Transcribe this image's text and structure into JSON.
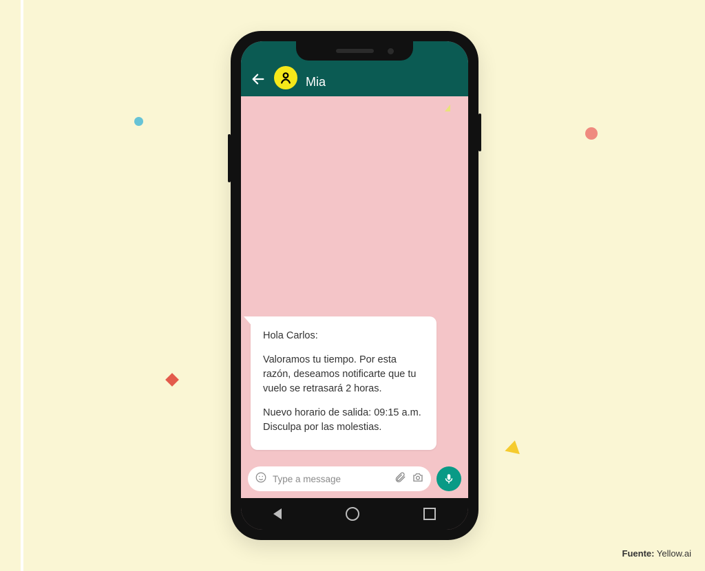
{
  "header": {
    "contact_name": "Mia"
  },
  "message": {
    "line1": "Hola Carlos:",
    "line2": "Valoramos tu tiempo. Por esta razón, deseamos notificarte que tu vuelo se retrasará 2 horas.",
    "line3": "Nuevo horario de salida: 09:15 a.m. Disculpa por las molestias."
  },
  "input": {
    "placeholder": "Type a message"
  },
  "source": {
    "label": "Fuente:",
    "value": "Yellow.ai"
  },
  "colors": {
    "page_bg": "#faf6d4",
    "chat_header": "#0b5b53",
    "chat_bg": "#f4c5c8",
    "avatar": "#f5e81a",
    "mic": "#099a86"
  }
}
